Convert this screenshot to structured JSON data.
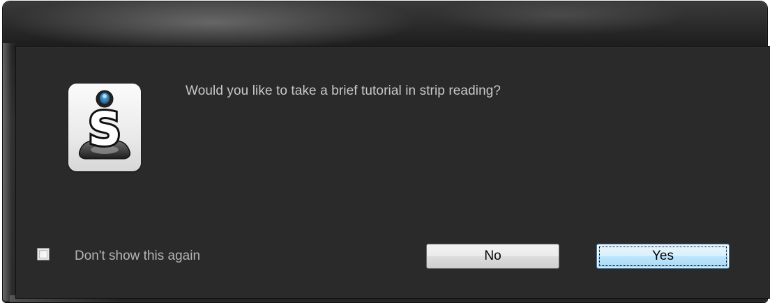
{
  "dialog": {
    "message": "Would you like to take a brief tutorial in strip reading?",
    "app_icon": "strip-reader-s-icon",
    "checkbox": {
      "label": "Don't show this again",
      "checked": false
    },
    "buttons": {
      "no_label": "No",
      "yes_label": "Yes",
      "default": "Yes"
    }
  },
  "colors": {
    "dialog_background": "#2a2a2a",
    "message_text": "#c9c9c9",
    "default_button_accent": "#3c7fb1"
  }
}
